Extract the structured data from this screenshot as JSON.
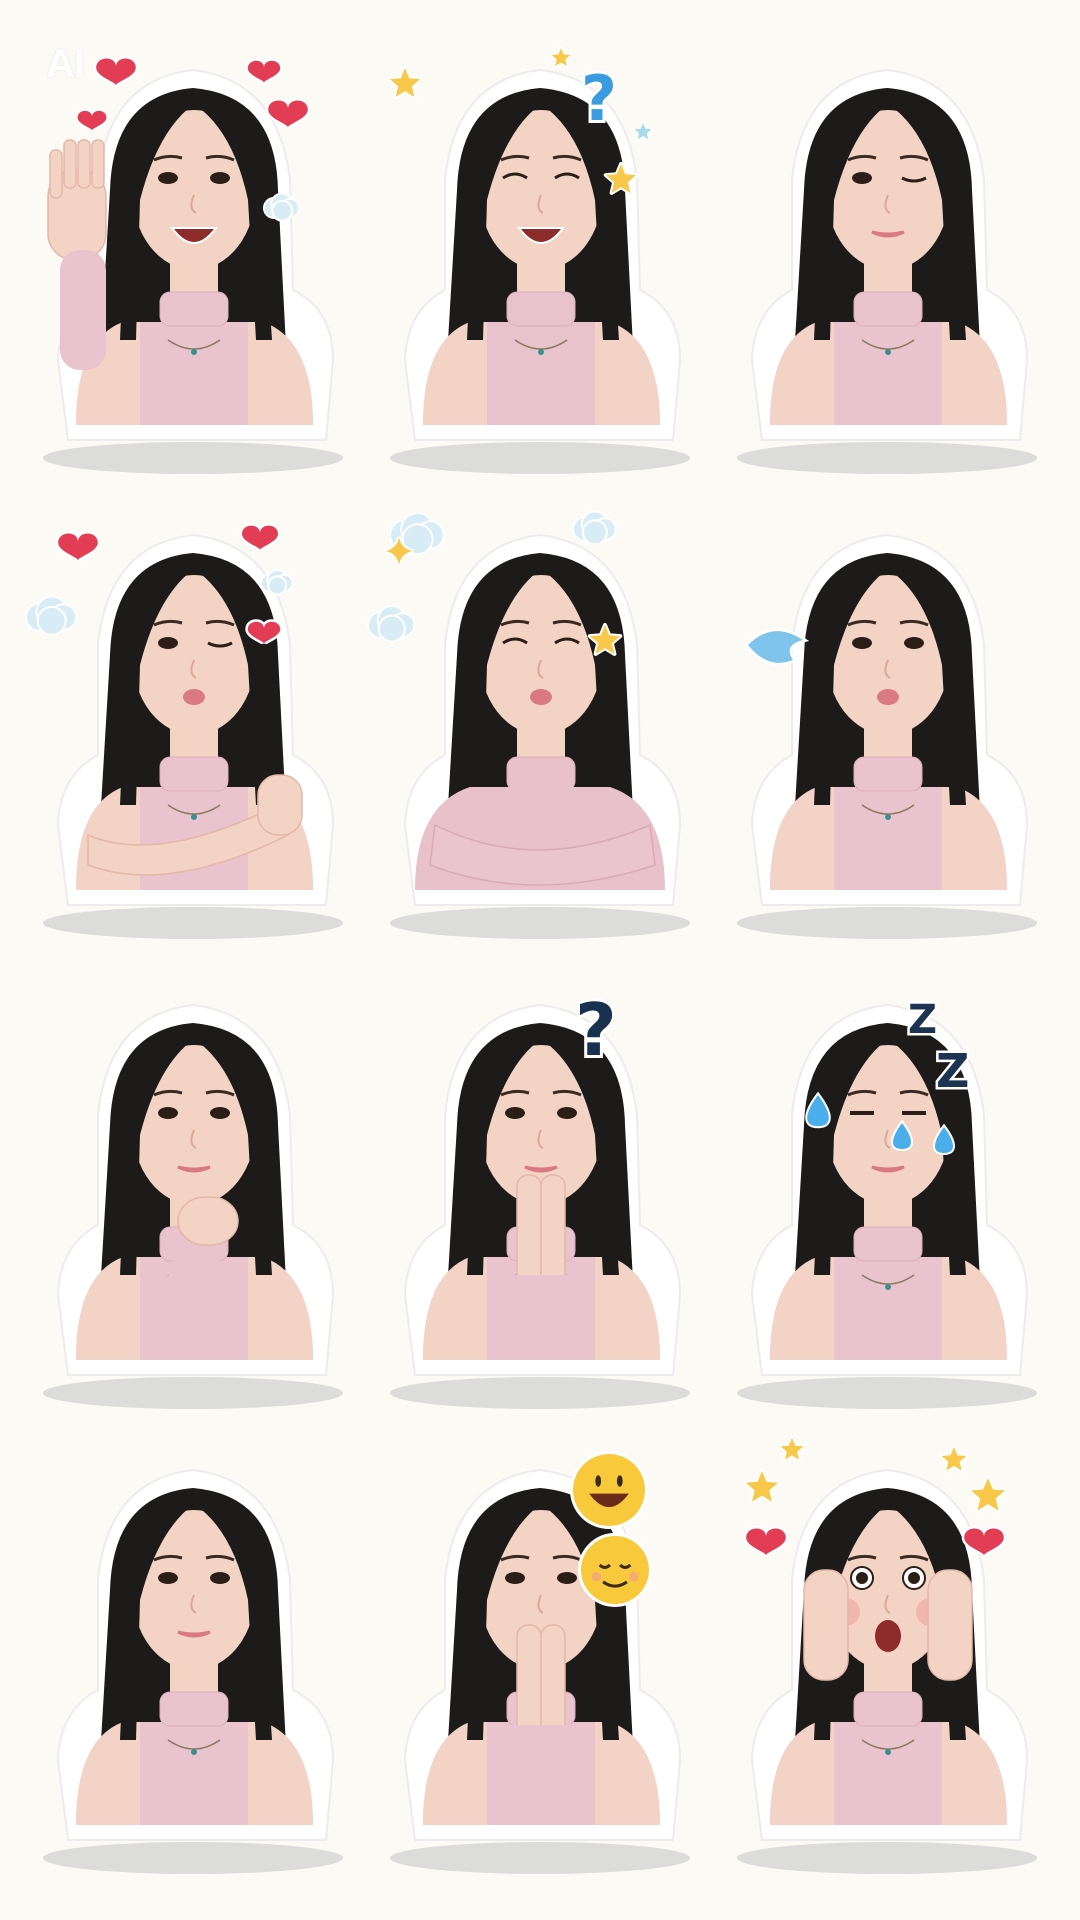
{
  "watermark": "AI",
  "stickers": [
    {
      "id": "waving-hearts",
      "expression": "open-smile",
      "pose": "wave",
      "decorations": [
        "heart",
        "heart",
        "heart",
        "heart",
        "cloud"
      ],
      "top_color": "#e9c3cd"
    },
    {
      "id": "laughing-question",
      "expression": "laugh",
      "pose": "plain",
      "decorations": [
        "star",
        "star",
        "question-mark-blue",
        "star-small",
        "star"
      ],
      "top_color": "#e8c2cc"
    },
    {
      "id": "winking-side",
      "expression": "wink",
      "pose": "plain",
      "decorations": [],
      "top_color": "#e9c3cd"
    },
    {
      "id": "hug-hearts",
      "expression": "wink-kiss",
      "pose": "hug",
      "decorations": [
        "heart",
        "heart",
        "heart",
        "cloud",
        "cloud"
      ],
      "top_color": "#e9c3cd"
    },
    {
      "id": "arms-crossed-clouds",
      "expression": "closed-pout",
      "pose": "arms-crossed",
      "decorations": [
        "cloud",
        "cloud",
        "cloud",
        "sparkle",
        "star"
      ],
      "top_color": "#e8c1cb"
    },
    {
      "id": "pout-swoosh",
      "expression": "pout",
      "pose": "plain",
      "decorations": [
        "swoosh"
      ],
      "top_color": "#e9c3cd"
    },
    {
      "id": "chin-rest",
      "expression": "neutral",
      "pose": "chin",
      "decorations": [],
      "top_color": "#e9c3cd"
    },
    {
      "id": "hands-pressed-question",
      "expression": "neutral",
      "pose": "pray",
      "decorations": [
        "question-mark-navy"
      ],
      "top_color": "#e9c3cd"
    },
    {
      "id": "sleepy-drops",
      "expression": "sleepy",
      "pose": "plain",
      "decorations": [
        "z",
        "z",
        "drop",
        "drop",
        "drop"
      ],
      "top_color": "#e9c3cd"
    },
    {
      "id": "side-glance",
      "expression": "neutral",
      "pose": "plain",
      "decorations": [],
      "top_color": "#e9c3cd"
    },
    {
      "id": "covering-mouth-emoji",
      "expression": "neutral",
      "pose": "cover-mouth",
      "decorations": [
        "emoji-grin",
        "emoji-relieved"
      ],
      "top_color": "#e9c3cd"
    },
    {
      "id": "surprised-stars",
      "expression": "surprised",
      "pose": "cheeks",
      "decorations": [
        "star",
        "star",
        "star",
        "star",
        "heart",
        "heart"
      ],
      "top_color": "#e9c3cd"
    }
  ],
  "colors": {
    "background": "#fbfaf4",
    "outline": "#ffffff",
    "shadow": "#cfcfcf",
    "hair": "#1d1b1a",
    "skin": "#f3d4c4",
    "heart": "#e33d55",
    "star": "#f7c84a",
    "cloud": "#d8ecf6",
    "question_blue": "#3a9be0",
    "question_navy": "#18314f",
    "z_navy": "#1c3452",
    "drop": "#4aaeea"
  }
}
